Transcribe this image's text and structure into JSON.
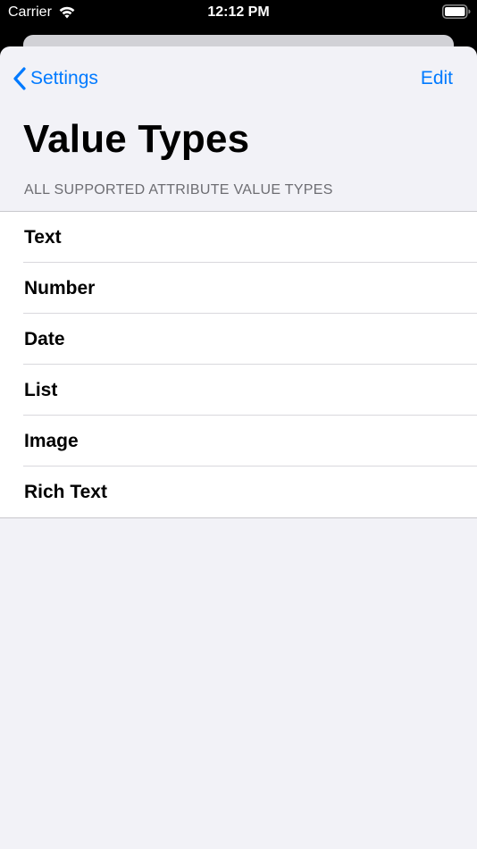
{
  "status_bar": {
    "carrier": "Carrier",
    "time": "12:12 PM",
    "wifi_icon": "wifi-icon",
    "battery_icon": "battery-icon"
  },
  "nav": {
    "back_label": "Settings",
    "back_icon": "chevron-left-icon",
    "edit_label": "Edit"
  },
  "page": {
    "title": "Value Types",
    "section_header": "ALL SUPPORTED ATTRIBUTE VALUE TYPES"
  },
  "items": [
    {
      "label": "Text"
    },
    {
      "label": "Number"
    },
    {
      "label": "Date"
    },
    {
      "label": "List"
    },
    {
      "label": "Image"
    },
    {
      "label": "Rich Text"
    }
  ],
  "colors": {
    "accent": "#007aff",
    "background": "#f2f2f7",
    "cell_background": "#ffffff",
    "secondary_text": "#6d6d72"
  }
}
